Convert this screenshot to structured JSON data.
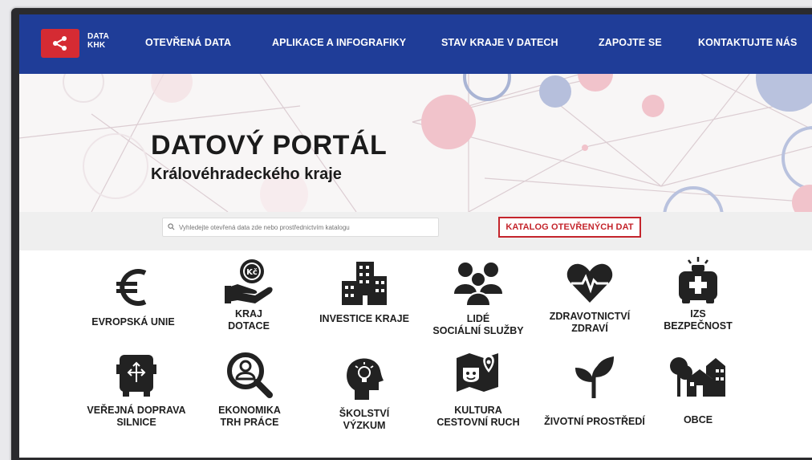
{
  "nav": {
    "logo_line1": "DATA",
    "logo_line2": "KHK",
    "items": [
      {
        "label": "OTEVŘENÁ DATA"
      },
      {
        "label": "APLIKACE A INFOGRAFIKY"
      },
      {
        "label": "STAV KRAJE V DATECH"
      },
      {
        "label": "ZAPOJTE SE"
      },
      {
        "label": "KONTAKTUJTE NÁS"
      }
    ]
  },
  "hero": {
    "title": "DATOVÝ PORTÁL",
    "subtitle": "Královéhradeckého kraje"
  },
  "search": {
    "placeholder": "Vyhledejte otevřená data zde nebo prostřednictvím katalogu",
    "catalog_label": "KATALOG OTEVŘENÝCH DAT"
  },
  "categories": [
    {
      "label": "EVROPSKÁ UNIE",
      "icon": "euro-icon"
    },
    {
      "label": "KRAJ\nDOTACE",
      "icon": "hand-coin-icon"
    },
    {
      "label": "INVESTICE KRAJE",
      "icon": "buildings-icon"
    },
    {
      "label": "LIDÉ\nSOCIÁLNÍ SLUŽBY",
      "icon": "people-icon"
    },
    {
      "label": "ZDRAVOTNICTVÍ\nZDRAVÍ",
      "icon": "heart-pulse-icon"
    },
    {
      "label": "IZS\nBEZPEČNOST",
      "icon": "ambulance-icon"
    },
    {
      "label": "VEŘEJNÁ DOPRAVA\nSILNICE",
      "icon": "bus-icon"
    },
    {
      "label": "EKONOMIKA\nTRH PRÁCE",
      "icon": "job-search-icon"
    },
    {
      "label": "ŠKOLSTVÍ\nVÝZKUM",
      "icon": "head-idea-icon"
    },
    {
      "label": "KULTURA\nCESTOVNÍ RUCH",
      "icon": "map-mask-icon"
    },
    {
      "label": "ŽIVOTNÍ PROSTŘEDÍ",
      "icon": "sprout-icon"
    },
    {
      "label": "OBCE",
      "icon": "town-icon"
    }
  ],
  "colors": {
    "nav_bg": "#1f3d98",
    "accent_red": "#c4252c",
    "icon_dark": "#222222"
  }
}
